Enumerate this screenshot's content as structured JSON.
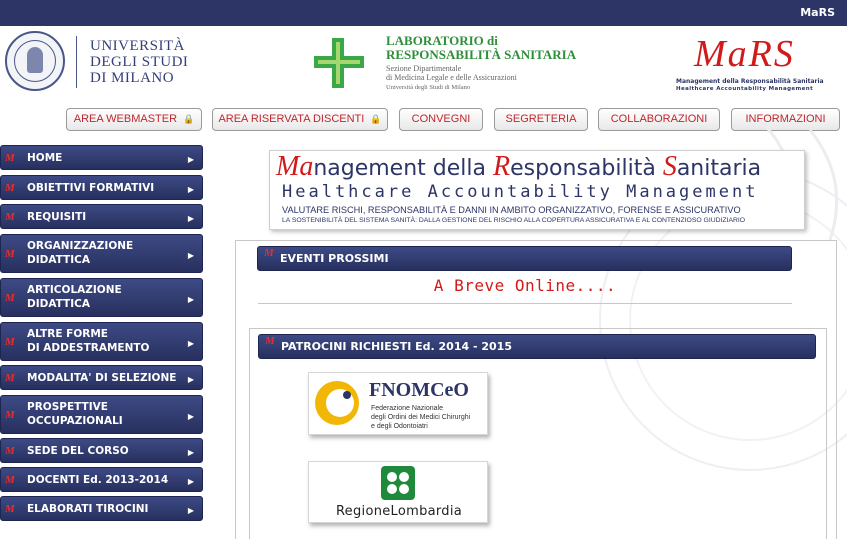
{
  "topbar": {
    "brand": "MaRS"
  },
  "colors": {
    "navy": "#2c3566",
    "red": "#d11b1b",
    "green": "#2f8f3b"
  },
  "header": {
    "university": {
      "line1": "UNIVERSITÀ",
      "line2": "DEGLI STUDI",
      "line3": "DI MILANO"
    },
    "lab": {
      "title1": "LABORATORIO di",
      "title2": "RESPONSABILITÀ SANITARIA",
      "sub1": "Sezione Dipartimentale",
      "sub2": "di Medicina Legale e delle Assicurazioni",
      "sub3": "Università degli Studi di Milano"
    },
    "mars": {
      "big": "MaRS",
      "line1": "Management della Responsabilità Sanitaria",
      "line2": "Healthcare Accountability Management"
    }
  },
  "topnav": [
    {
      "label": "AREA WEBMASTER",
      "icon": "lock-icon"
    },
    {
      "label": "AREA RISERVATA DISCENTI",
      "icon": "lock-icon"
    },
    {
      "label": "CONVEGNI"
    },
    {
      "label": "SEGRETERIA"
    },
    {
      "label": "COLLABORAZIONI"
    },
    {
      "label": "INFORMAZIONI"
    }
  ],
  "sidebar": [
    {
      "line1": "HOME"
    },
    {
      "line1": "OBIETTIVI FORMATIVI"
    },
    {
      "line1": "REQUISITI"
    },
    {
      "line1": "ORGANIZZAZIONE",
      "line2": "DIDATTICA"
    },
    {
      "line1": "ARTICOLAZIONE",
      "line2": "DIDATTICA"
    },
    {
      "line1": "ALTRE FORME",
      "line2": "DI ADDESTRAMENTO"
    },
    {
      "line1": "MODALITA' DI SELEZIONE"
    },
    {
      "line1": "PROSPETTIVE",
      "line2": "OCCUPAZIONALI"
    },
    {
      "line1": "SEDE DEL CORSO"
    },
    {
      "line1": "DOCENTI Ed. 2013-2014"
    },
    {
      "line1": "ELABORATI TIROCINI"
    }
  ],
  "banner": {
    "title_a": "Ma",
    "title_b": "nagement della ",
    "title_c": "R",
    "title_d": "esponsabilità ",
    "title_e": "S",
    "title_f": "anitaria",
    "subtitle": "Healthcare Accountability Management",
    "tagline1": "VALUTARE RISCHI, RESPONSABILITÀ E DANNI IN AMBITO ORGANIZZATIVO, FORENSE E ASSICURATIVO",
    "tagline2": "LA SOSTENIBILITÀ DEL SISTEMA SANITÀ: DALLA GESTIONE DEL RISCHIO ALLA COPERTURA ASSICURATIVA E AL CONTENZIOSO GIUDIZIARIO"
  },
  "eventi": {
    "heading": "EVENTI PROSSIMI",
    "message": "A Breve Online...."
  },
  "patrocini": {
    "heading": "PATROCINI RICHIESTI Ed. 2014 - 2015",
    "fnomceo": {
      "name": "FNOMCeO",
      "desc1": "Federazione Nazionale",
      "desc2": "degli Ordini dei Medici Chirurghi",
      "desc3": "e degli Odontoiatri"
    },
    "lombardia": {
      "name": "RegioneLombardia"
    }
  }
}
